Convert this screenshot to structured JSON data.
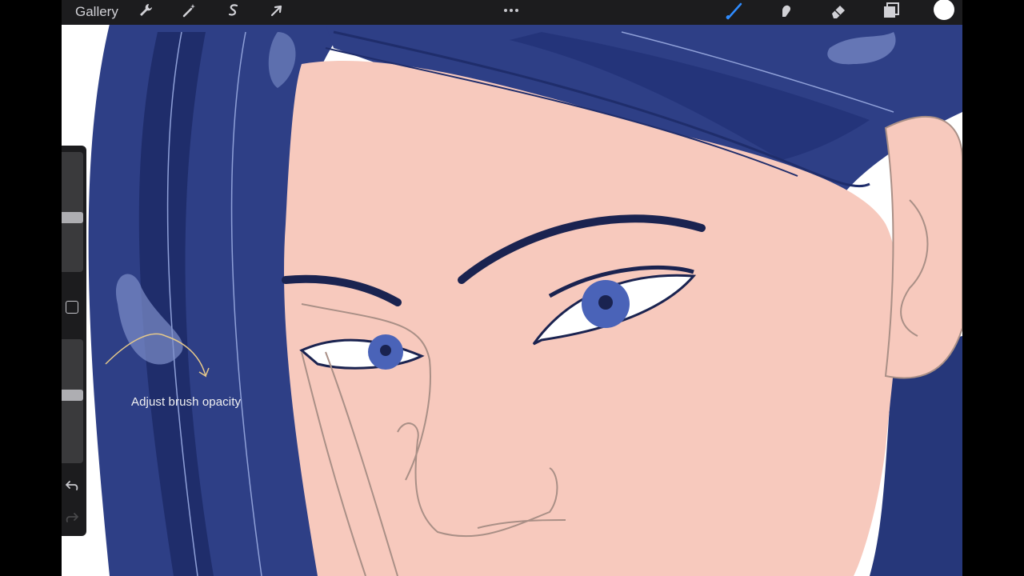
{
  "toolbar": {
    "gallery_label": "Gallery",
    "left_tools": [
      {
        "name": "actions",
        "icon": "wrench-icon"
      },
      {
        "name": "adjustments",
        "icon": "magic-wand-icon"
      },
      {
        "name": "selection",
        "icon": "selection-s-icon"
      },
      {
        "name": "transform",
        "icon": "arrow-cursor-icon"
      }
    ],
    "more_icon": "ellipsis-icon",
    "right_tools": [
      {
        "name": "brush",
        "icon": "brush-icon",
        "active": true
      },
      {
        "name": "smudge",
        "icon": "smudge-finger-icon"
      },
      {
        "name": "eraser",
        "icon": "eraser-icon"
      },
      {
        "name": "layers",
        "icon": "layers-icon"
      }
    ],
    "current_color": "#ffffff"
  },
  "sidebar": {
    "brush_size_level": 0.45,
    "brush_opacity_level": 0.55,
    "modify_icon": "square-outline-icon",
    "undo_icon": "undo-arrow-icon",
    "redo_icon": "redo-arrow-icon"
  },
  "hint": {
    "text": "Adjust brush opacity",
    "color": "#e6c98a"
  },
  "colors": {
    "accent": "#2f8cff",
    "hair_dark": "#1f2d6b",
    "hair_mid": "#2e3f86",
    "skin": "#f7c9bd",
    "iris": "#4a63b8"
  }
}
